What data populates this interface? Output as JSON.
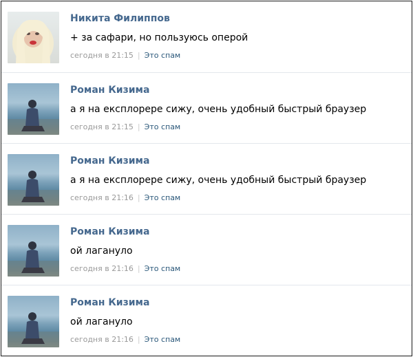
{
  "comments": [
    {
      "author": "Никита Филиппов",
      "text": "+ за сафари, но пользуюсь оперой",
      "time": "сегодня в 21:15",
      "spam_label": "Это спам",
      "avatar": "girl-blonde-avatar"
    },
    {
      "author": "Роман Кизима",
      "text": "а я на експлорере сижу, очень удобный быстрый браузер",
      "time": "сегодня в 21:15",
      "spam_label": "Это спам",
      "avatar": "man-beach-avatar"
    },
    {
      "author": "Роман Кизима",
      "text": "а я на експлорере сижу, очень удобный быстрый браузер",
      "time": "сегодня в 21:16",
      "spam_label": "Это спам",
      "avatar": "man-beach-avatar"
    },
    {
      "author": "Роман Кизима",
      "text": "ой лагануло",
      "time": "сегодня в 21:16",
      "spam_label": "Это спам",
      "avatar": "man-beach-avatar"
    },
    {
      "author": "Роман Кизима",
      "text": "ой лагануло",
      "time": "сегодня в 21:16",
      "spam_label": "Это спам",
      "avatar": "man-beach-avatar"
    }
  ],
  "colors": {
    "link": "#45688e",
    "meta": "#999999",
    "spam": "#2b587a",
    "divider": "#e3e7ec"
  }
}
